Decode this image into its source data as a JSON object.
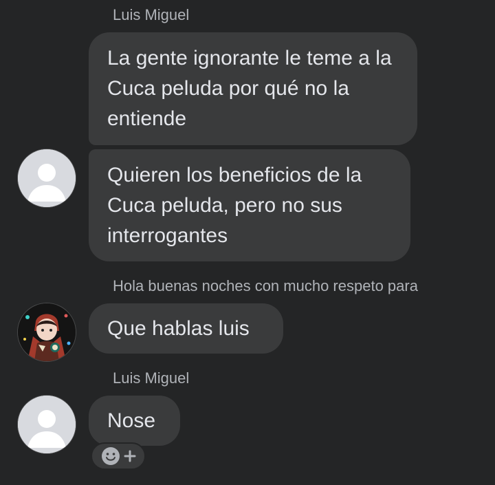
{
  "conversation": {
    "messages": [
      {
        "sender": "Luis Miguel",
        "text": "La gente ignorante le teme a la Cuca peluda por qué no la entiende"
      },
      {
        "text": "Quieren los beneficios de la Cuca peluda, pero no sus interrogantes",
        "avatar": "default-avatar-icon"
      },
      {
        "sender": "Hola buenas noches con mucho respeto para",
        "text": "Que hablas luis",
        "avatar": "profile-photo"
      },
      {
        "sender": "Luis Miguel",
        "text": "Nose",
        "avatar": "default-avatar-icon"
      }
    ]
  },
  "reaction_button": {
    "icons": [
      "smiley-icon",
      "plus-icon"
    ]
  },
  "colors": {
    "background": "#242526",
    "bubble": "#3a3b3c",
    "bubble_text": "#e4e6eb",
    "sender_text": "#b0b3b8"
  }
}
